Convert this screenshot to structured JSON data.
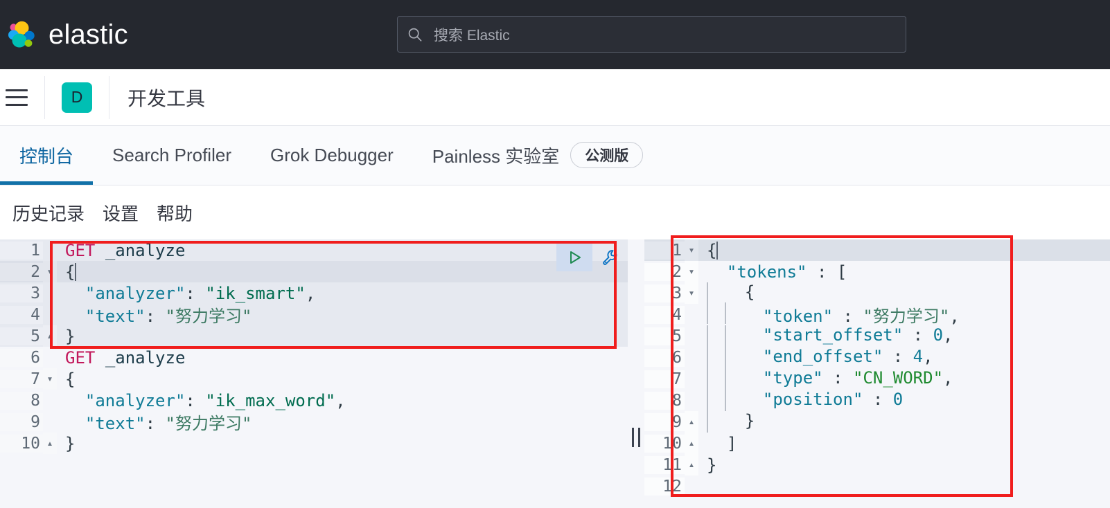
{
  "topbar": {
    "brand_name": "elastic",
    "search": {
      "placeholder": "搜索 Elastic",
      "value": ""
    },
    "logo_colors": {
      "yellow": "#fec514",
      "pink": "#ee5098",
      "teal": "#00bfb3",
      "blue": "#1ba9f5",
      "lightblue": "#93c90e",
      "green": "#07c",
      "darkblue": "#0077cc"
    },
    "background": "#25282f"
  },
  "header": {
    "menu_label": "菜单",
    "app_badge": "D",
    "app_badge_color": "#00bfb3",
    "app_title": "开发工具"
  },
  "tabs": {
    "accent_color": "#1171a8",
    "items": [
      {
        "label": "控制台",
        "active": true
      },
      {
        "label": "Search Profiler",
        "active": false
      },
      {
        "label": "Grok Debugger",
        "active": false
      },
      {
        "label": "Painless 实验室",
        "active": false,
        "badge": "公测版"
      }
    ]
  },
  "console_toolbar": {
    "items": [
      {
        "label": "历史记录"
      },
      {
        "label": "设置"
      },
      {
        "label": "帮助"
      }
    ]
  },
  "editor": {
    "play_title": "发送请求",
    "wrench_title": "设置",
    "selected_range": [
      1,
      5
    ],
    "active_line": 2,
    "lines": [
      {
        "num": "1",
        "fold": "",
        "sel": true,
        "active": false,
        "tokens": [
          {
            "t": "method",
            "v": "GET"
          },
          {
            "t": "plain",
            "v": " "
          },
          {
            "t": "url",
            "v": "_analyze"
          }
        ]
      },
      {
        "num": "2",
        "fold": "▾",
        "sel": true,
        "active": true,
        "tokens": [
          {
            "t": "brace",
            "v": "{"
          },
          {
            "t": "caret",
            "v": ""
          }
        ]
      },
      {
        "num": "3",
        "fold": "",
        "sel": true,
        "active": false,
        "tokens": [
          {
            "t": "plain",
            "v": "  "
          },
          {
            "t": "key",
            "v": "\"analyzer\""
          },
          {
            "t": "punct",
            "v": ":"
          },
          {
            "t": "plain",
            "v": " "
          },
          {
            "t": "str",
            "v": "\"ik_smart\""
          },
          {
            "t": "punct",
            "v": ","
          }
        ]
      },
      {
        "num": "4",
        "fold": "",
        "sel": true,
        "active": false,
        "tokens": [
          {
            "t": "plain",
            "v": "  "
          },
          {
            "t": "key",
            "v": "\"text\""
          },
          {
            "t": "punct",
            "v": ":"
          },
          {
            "t": "plain",
            "v": " "
          },
          {
            "t": "strcn",
            "v": "\"努力学习\""
          }
        ]
      },
      {
        "num": "5",
        "fold": "▴",
        "sel": true,
        "active": false,
        "tokens": [
          {
            "t": "brace",
            "v": "}"
          }
        ]
      },
      {
        "num": "6",
        "fold": "",
        "sel": false,
        "active": false,
        "tokens": [
          {
            "t": "method",
            "v": "GET"
          },
          {
            "t": "plain",
            "v": " "
          },
          {
            "t": "url",
            "v": "_analyze"
          }
        ]
      },
      {
        "num": "7",
        "fold": "▾",
        "sel": false,
        "active": false,
        "tokens": [
          {
            "t": "brace",
            "v": "{"
          }
        ]
      },
      {
        "num": "8",
        "fold": "",
        "sel": false,
        "active": false,
        "tokens": [
          {
            "t": "plain",
            "v": "  "
          },
          {
            "t": "key",
            "v": "\"analyzer\""
          },
          {
            "t": "punct",
            "v": ":"
          },
          {
            "t": "plain",
            "v": " "
          },
          {
            "t": "str",
            "v": "\"ik_max_word\""
          },
          {
            "t": "punct",
            "v": ","
          }
        ]
      },
      {
        "num": "9",
        "fold": "",
        "sel": false,
        "active": false,
        "tokens": [
          {
            "t": "plain",
            "v": "  "
          },
          {
            "t": "key",
            "v": "\"text\""
          },
          {
            "t": "punct",
            "v": ":"
          },
          {
            "t": "plain",
            "v": " "
          },
          {
            "t": "strcn",
            "v": "\"努力学习\""
          }
        ]
      },
      {
        "num": "10",
        "fold": "▴",
        "sel": false,
        "active": false,
        "tokens": [
          {
            "t": "brace",
            "v": "}"
          }
        ]
      }
    ]
  },
  "response": {
    "active_line": 1,
    "lines": [
      {
        "num": "1",
        "fold": "▾",
        "active": true,
        "tokens": [
          {
            "t": "brace",
            "v": "{"
          },
          {
            "t": "caret",
            "v": ""
          }
        ]
      },
      {
        "num": "2",
        "fold": "▾",
        "active": false,
        "tokens": [
          {
            "t": "plain",
            "v": "  "
          },
          {
            "t": "key",
            "v": "\"tokens\""
          },
          {
            "t": "plain",
            "v": " "
          },
          {
            "t": "punct",
            "v": ":"
          },
          {
            "t": "plain",
            "v": " "
          },
          {
            "t": "brace",
            "v": "["
          }
        ]
      },
      {
        "num": "3",
        "fold": "▾",
        "active": false,
        "indent": 1,
        "tokens": [
          {
            "t": "brace",
            "v": "{"
          }
        ]
      },
      {
        "num": "4",
        "fold": "",
        "active": false,
        "indent": 2,
        "tokens": [
          {
            "t": "key",
            "v": "\"token\""
          },
          {
            "t": "plain",
            "v": " "
          },
          {
            "t": "punct",
            "v": ":"
          },
          {
            "t": "plain",
            "v": " "
          },
          {
            "t": "strcn",
            "v": "\"努力学习\""
          },
          {
            "t": "punct",
            "v": ","
          }
        ]
      },
      {
        "num": "5",
        "fold": "",
        "active": false,
        "indent": 2,
        "tokens": [
          {
            "t": "key",
            "v": "\"start_offset\""
          },
          {
            "t": "plain",
            "v": " "
          },
          {
            "t": "punct",
            "v": ":"
          },
          {
            "t": "plain",
            "v": " "
          },
          {
            "t": "num",
            "v": "0"
          },
          {
            "t": "punct",
            "v": ","
          }
        ]
      },
      {
        "num": "6",
        "fold": "",
        "active": false,
        "indent": 2,
        "tokens": [
          {
            "t": "key",
            "v": "\"end_offset\""
          },
          {
            "t": "plain",
            "v": " "
          },
          {
            "t": "punct",
            "v": ":"
          },
          {
            "t": "plain",
            "v": " "
          },
          {
            "t": "num",
            "v": "4"
          },
          {
            "t": "punct",
            "v": ","
          }
        ]
      },
      {
        "num": "7",
        "fold": "",
        "active": false,
        "indent": 2,
        "tokens": [
          {
            "t": "key",
            "v": "\"type\""
          },
          {
            "t": "plain",
            "v": " "
          },
          {
            "t": "punct",
            "v": ":"
          },
          {
            "t": "plain",
            "v": " "
          },
          {
            "t": "strg",
            "v": "\"CN_WORD\""
          },
          {
            "t": "punct",
            "v": ","
          }
        ]
      },
      {
        "num": "8",
        "fold": "",
        "active": false,
        "indent": 2,
        "tokens": [
          {
            "t": "key",
            "v": "\"position\""
          },
          {
            "t": "plain",
            "v": " "
          },
          {
            "t": "punct",
            "v": ":"
          },
          {
            "t": "plain",
            "v": " "
          },
          {
            "t": "num",
            "v": "0"
          }
        ]
      },
      {
        "num": "9",
        "fold": "▴",
        "active": false,
        "indent": 1,
        "tokens": [
          {
            "t": "brace",
            "v": "}"
          }
        ]
      },
      {
        "num": "10",
        "fold": "▴",
        "active": false,
        "tokens": [
          {
            "t": "plain",
            "v": "  "
          },
          {
            "t": "brace",
            "v": "]"
          }
        ]
      },
      {
        "num": "11",
        "fold": "▴",
        "active": false,
        "tokens": [
          {
            "t": "brace",
            "v": "}"
          }
        ]
      },
      {
        "num": "12",
        "fold": "",
        "active": false,
        "tokens": []
      }
    ]
  },
  "annotations": {
    "highlight_color": "#f01d1d",
    "boxes": [
      {
        "name": "request-highlight"
      },
      {
        "name": "response-highlight"
      }
    ]
  }
}
